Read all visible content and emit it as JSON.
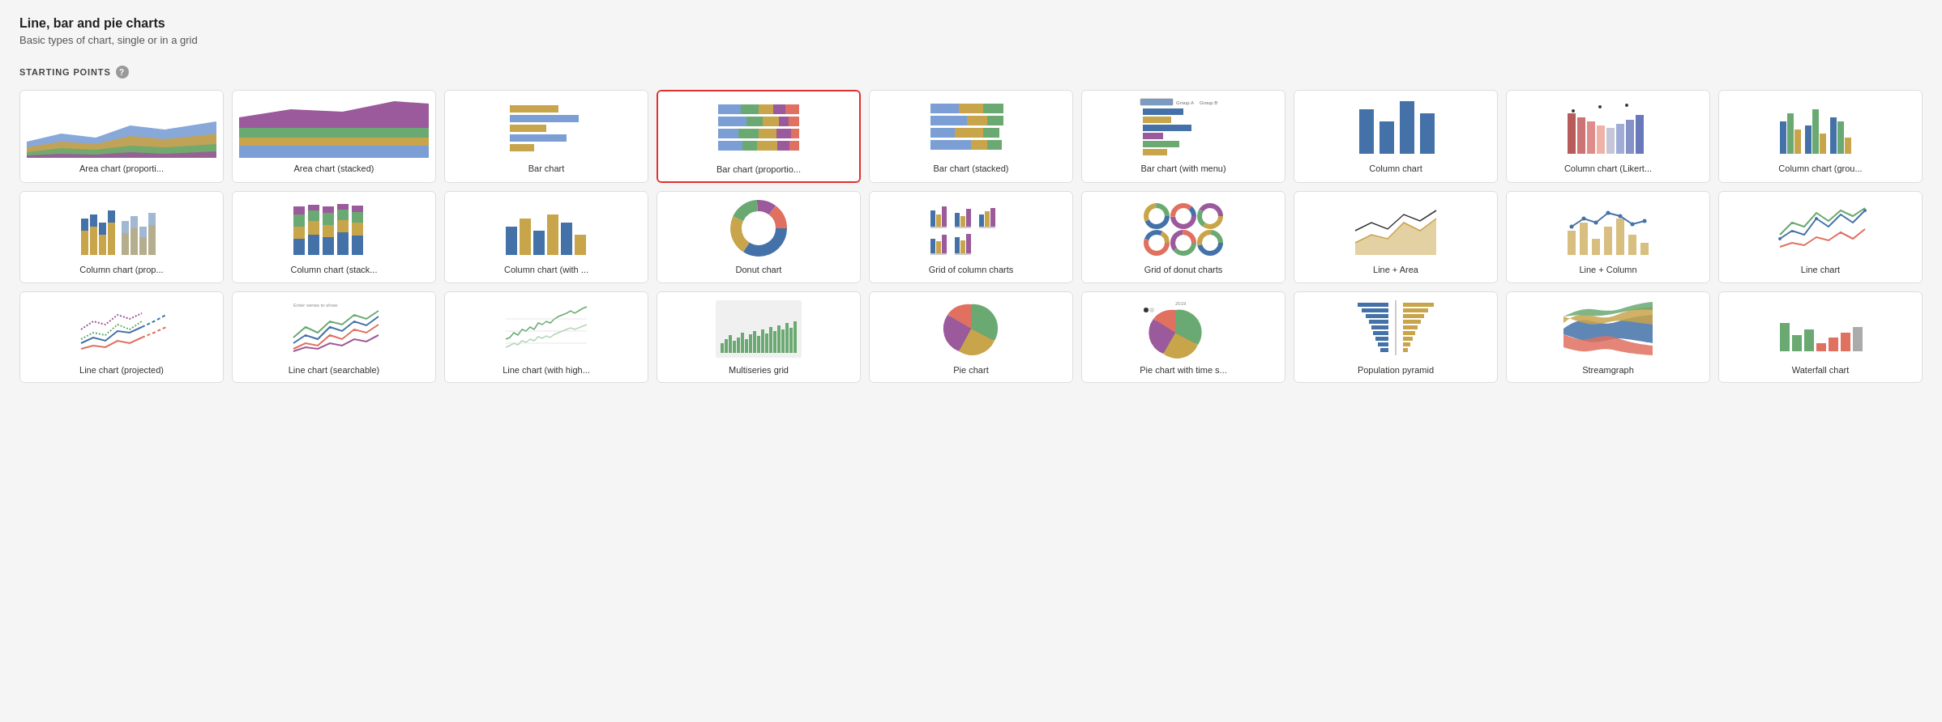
{
  "page": {
    "title": "Line, bar and pie charts",
    "subtitle": "Basic types of chart, single or in a grid",
    "section_label": "STARTING POINTS",
    "help_tooltip": "?"
  },
  "charts": [
    {
      "id": "area-proportional",
      "label": "Area chart (proporti...",
      "selected": false
    },
    {
      "id": "area-stacked",
      "label": "Area chart (stacked)",
      "selected": false
    },
    {
      "id": "bar-chart",
      "label": "Bar chart",
      "selected": false
    },
    {
      "id": "bar-proportional",
      "label": "Bar chart (proportio...",
      "selected": true
    },
    {
      "id": "bar-stacked",
      "label": "Bar chart (stacked)",
      "selected": false
    },
    {
      "id": "bar-menu",
      "label": "Bar chart (with menu)",
      "selected": false
    },
    {
      "id": "column-chart",
      "label": "Column chart",
      "selected": false
    },
    {
      "id": "column-likert",
      "label": "Column chart (Likert...",
      "selected": false
    },
    {
      "id": "column-grouped",
      "label": "Column chart (grou...",
      "selected": false
    },
    {
      "id": "column-projected",
      "label": "Column chart (prop...",
      "selected": false
    },
    {
      "id": "column-stacked",
      "label": "Column chart (stack...",
      "selected": false
    },
    {
      "id": "column-with",
      "label": "Column chart (with ...",
      "selected": false
    },
    {
      "id": "donut-chart",
      "label": "Donut chart",
      "selected": false
    },
    {
      "id": "grid-column",
      "label": "Grid of column charts",
      "selected": false
    },
    {
      "id": "grid-donut",
      "label": "Grid of donut charts",
      "selected": false
    },
    {
      "id": "line-area",
      "label": "Line + Area",
      "selected": false
    },
    {
      "id": "line-column",
      "label": "Line + Column",
      "selected": false
    },
    {
      "id": "line-chart",
      "label": "Line chart",
      "selected": false
    },
    {
      "id": "line-projected",
      "label": "Line chart (projected)",
      "selected": false
    },
    {
      "id": "line-searchable",
      "label": "Line chart (searchable)",
      "selected": false
    },
    {
      "id": "line-high",
      "label": "Line chart (with high...",
      "selected": false
    },
    {
      "id": "multiseries-grid",
      "label": "Multiseries grid",
      "selected": false
    },
    {
      "id": "pie-chart",
      "label": "Pie chart",
      "selected": false
    },
    {
      "id": "pie-time",
      "label": "Pie chart with time s...",
      "selected": false
    },
    {
      "id": "population-pyramid",
      "label": "Population pyramid",
      "selected": false
    },
    {
      "id": "streamgraph",
      "label": "Streamgraph",
      "selected": false
    },
    {
      "id": "waterfall-chart",
      "label": "Waterfall chart",
      "selected": false
    }
  ]
}
